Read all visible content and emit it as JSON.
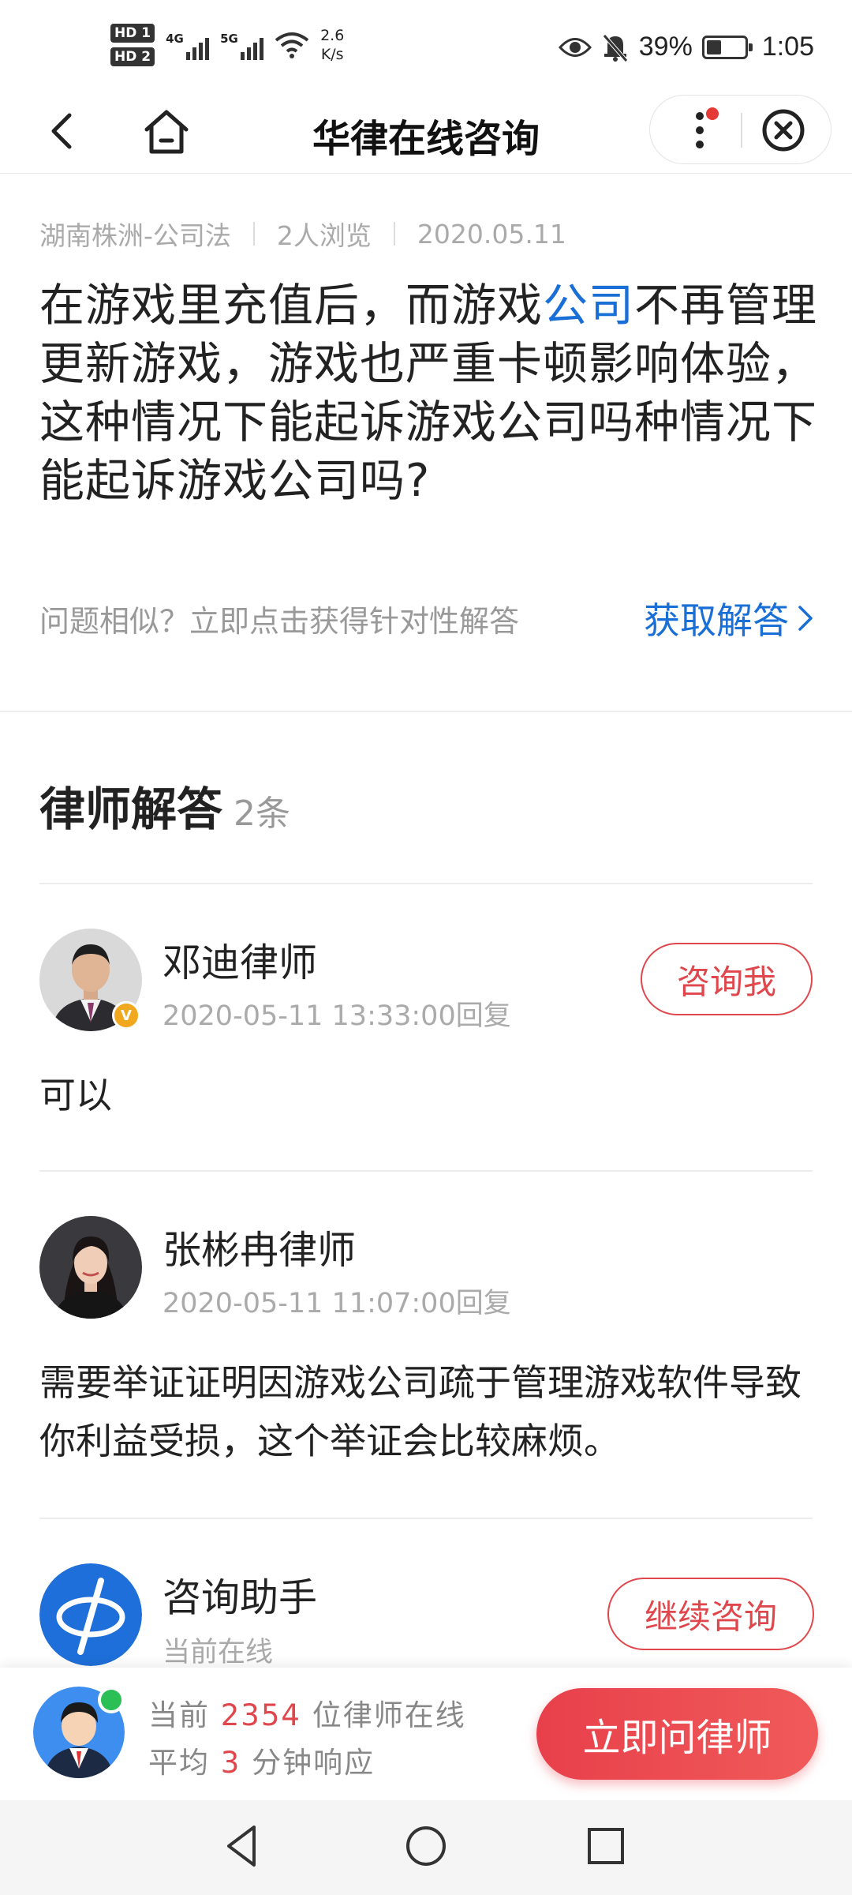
{
  "status_bar": {
    "sim1": "HD 1",
    "sim2": "HD 2",
    "net1": "4G",
    "net2": "5G",
    "speed_value": "2.6",
    "speed_unit": "K/s",
    "battery": "39%",
    "battery_level": 0.39,
    "time": "1:05",
    "icons": [
      "eye-icon",
      "bell-off-icon",
      "wifi-icon",
      "battery-icon"
    ]
  },
  "nav": {
    "title": "华律在线咨询",
    "icons": [
      "back-icon",
      "home-icon",
      "more-icon",
      "close-icon"
    ],
    "notification_dot_color": "#e53935"
  },
  "question": {
    "location": "湖南株洲-公司法",
    "views": "2人浏览",
    "date": "2020.05.11",
    "text_before": "在游戏里充值后，而游戏",
    "text_highlight": "公司",
    "text_after": "不再管理更新游戏，游戏也严重卡顿影响体验，这种情况下能起诉游戏公司吗种情况下能起诉游戏公司吗?",
    "similar_prompt": "问题相似？立即点击获得针对性解答",
    "get_answer": "获取解答",
    "link_color": "#1a6fd6"
  },
  "answers": {
    "heading": "律师解答",
    "count": "2条",
    "items": [
      {
        "name": "邓迪律师",
        "time": "2020-05-11 13:33:00回复",
        "text": "可以",
        "button": "咨询我",
        "verified_badge": "V"
      },
      {
        "name": "张彬冉律师",
        "time": "2020-05-11 11:07:00回复",
        "text": "需要举证证明因游戏公司疏于管理游戏软件导致你利益受损，这个举证会比较麻烦。"
      }
    ],
    "assistant": {
      "name": "咨询助手",
      "status": "当前在线",
      "button": "继续咨询"
    }
  },
  "bottom_bar": {
    "line1_prefix": "当前",
    "lawyers_online": "2354",
    "line1_suffix": "位律师在线",
    "line2_prefix": "平均",
    "minutes": "3",
    "line2_suffix": "分钟响应",
    "ask_button": "立即问律师",
    "accent_color": "#e8404b"
  },
  "system_nav": {
    "icons": [
      "nav-back-triangle-icon",
      "nav-home-circle-icon",
      "nav-recents-square-icon"
    ]
  }
}
